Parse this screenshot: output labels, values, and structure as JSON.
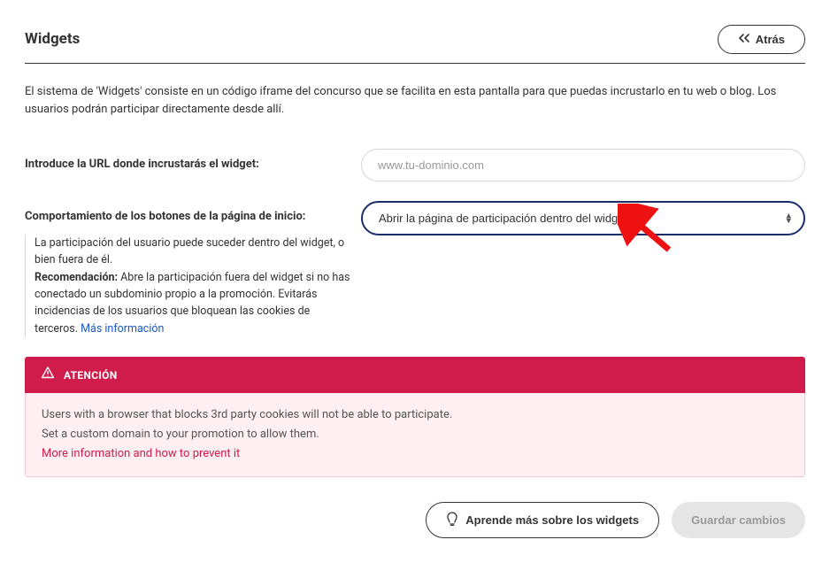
{
  "header": {
    "title": "Widgets",
    "back_label": "Atrás"
  },
  "intro": "El sistema de 'Widgets' consiste en un código iframe del concurso que se facilita en esta pantalla para que puedas incrustarlo en tu web o blog. Los usuarios podrán participar directamente desde allí.",
  "fields": {
    "url_label": "Introduce la URL donde incrustarás el widget:",
    "url_placeholder": "www.tu-dominio.com",
    "behavior_label": "Comportamiento de los botones de la página de inicio:",
    "behavior_value": "Abrir la página de participación dentro del widget",
    "helper_line1": "La participación del usuario puede suceder dentro del widget, o bien fuera de él.",
    "helper_strong": "Recomendación:",
    "helper_line2": " Abre la participación fuera del widget si no has conectado un subdominio propio a la promoción. Evitarás incidencias de los usuarios que bloquean las cookies de terceros. ",
    "helper_link": "Más información"
  },
  "alert": {
    "title": "ATENCIÓN",
    "line1": "Users with a browser that blocks 3rd party cookies will not be able to participate.",
    "line2": "Set a custom domain to your promotion to allow them.",
    "link": "More information and how to prevent it"
  },
  "footer": {
    "learn_label": "Aprende más sobre los widgets",
    "save_label": "Guardar cambios"
  }
}
